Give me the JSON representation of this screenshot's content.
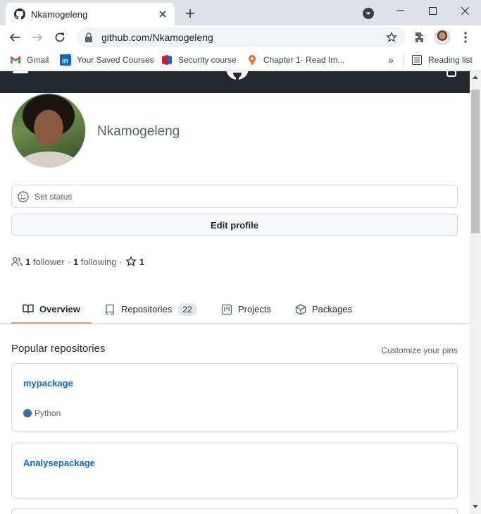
{
  "browser": {
    "tab_title": "Nkamogeleng",
    "url": "github.com/Nkamogeleng",
    "bookmarks": [
      {
        "label": "Gmail",
        "icon": "gmail-icon"
      },
      {
        "label": "Your Saved Courses",
        "icon": "linkedin-icon"
      },
      {
        "label": "Security course",
        "icon": "security-course-icon"
      },
      {
        "label": "Chapter 1- Read Im...",
        "icon": "chapter-icon"
      }
    ],
    "reading_list": "Reading list",
    "overflow": "»"
  },
  "profile": {
    "username": "Nkamogeleng",
    "set_status": "Set status",
    "edit_profile": "Edit profile",
    "followers_count": "1",
    "followers_label": "follower",
    "following_count": "1",
    "following_label": "following",
    "stars_count": "1",
    "separator": "·"
  },
  "tabs": [
    {
      "label": "Overview",
      "icon": "book-icon",
      "active": true
    },
    {
      "label": "Repositories",
      "icon": "repo-icon",
      "counter": "22"
    },
    {
      "label": "Projects",
      "icon": "project-icon"
    },
    {
      "label": "Packages",
      "icon": "package-icon"
    }
  ],
  "popular": {
    "title": "Popular repositories",
    "customize": "Customize your pins",
    "repos": [
      {
        "name": "mypackage",
        "language": "Python",
        "language_color": "#3572A5"
      },
      {
        "name": "Analysepackage"
      }
    ]
  },
  "colors": {
    "header_bg": "#24292f",
    "link": "#0969da",
    "active_tab_underline": "#fd8c73"
  }
}
